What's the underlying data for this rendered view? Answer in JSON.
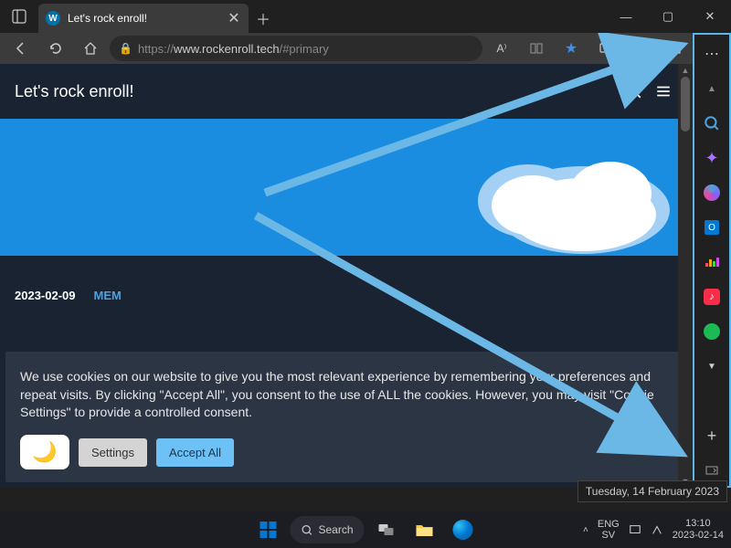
{
  "tab": {
    "title": "Let's rock enroll!"
  },
  "url": {
    "scheme": "https://",
    "host": "www.rockenroll.tech",
    "path": "/#primary"
  },
  "site": {
    "title": "Let's rock enroll!"
  },
  "post": {
    "date": "2023-02-09",
    "category": "MEM"
  },
  "cookie": {
    "text": "We use cookies on our website to give you the most relevant experience by remembering your preferences and repeat visits. By clicking \"Accept All\", you consent to the use of ALL the cookies. However, you may visit \"Cookie Settings\" to provide a controlled consent.",
    "settings": "Settings",
    "accept": "Accept All"
  },
  "taskbar": {
    "search": "Search"
  },
  "tray": {
    "lang1": "ENG",
    "lang2": "SV",
    "time": "13:10",
    "date": "2023-02-14"
  },
  "tooltip": {
    "date": "Tuesday, 14 February 2023"
  }
}
